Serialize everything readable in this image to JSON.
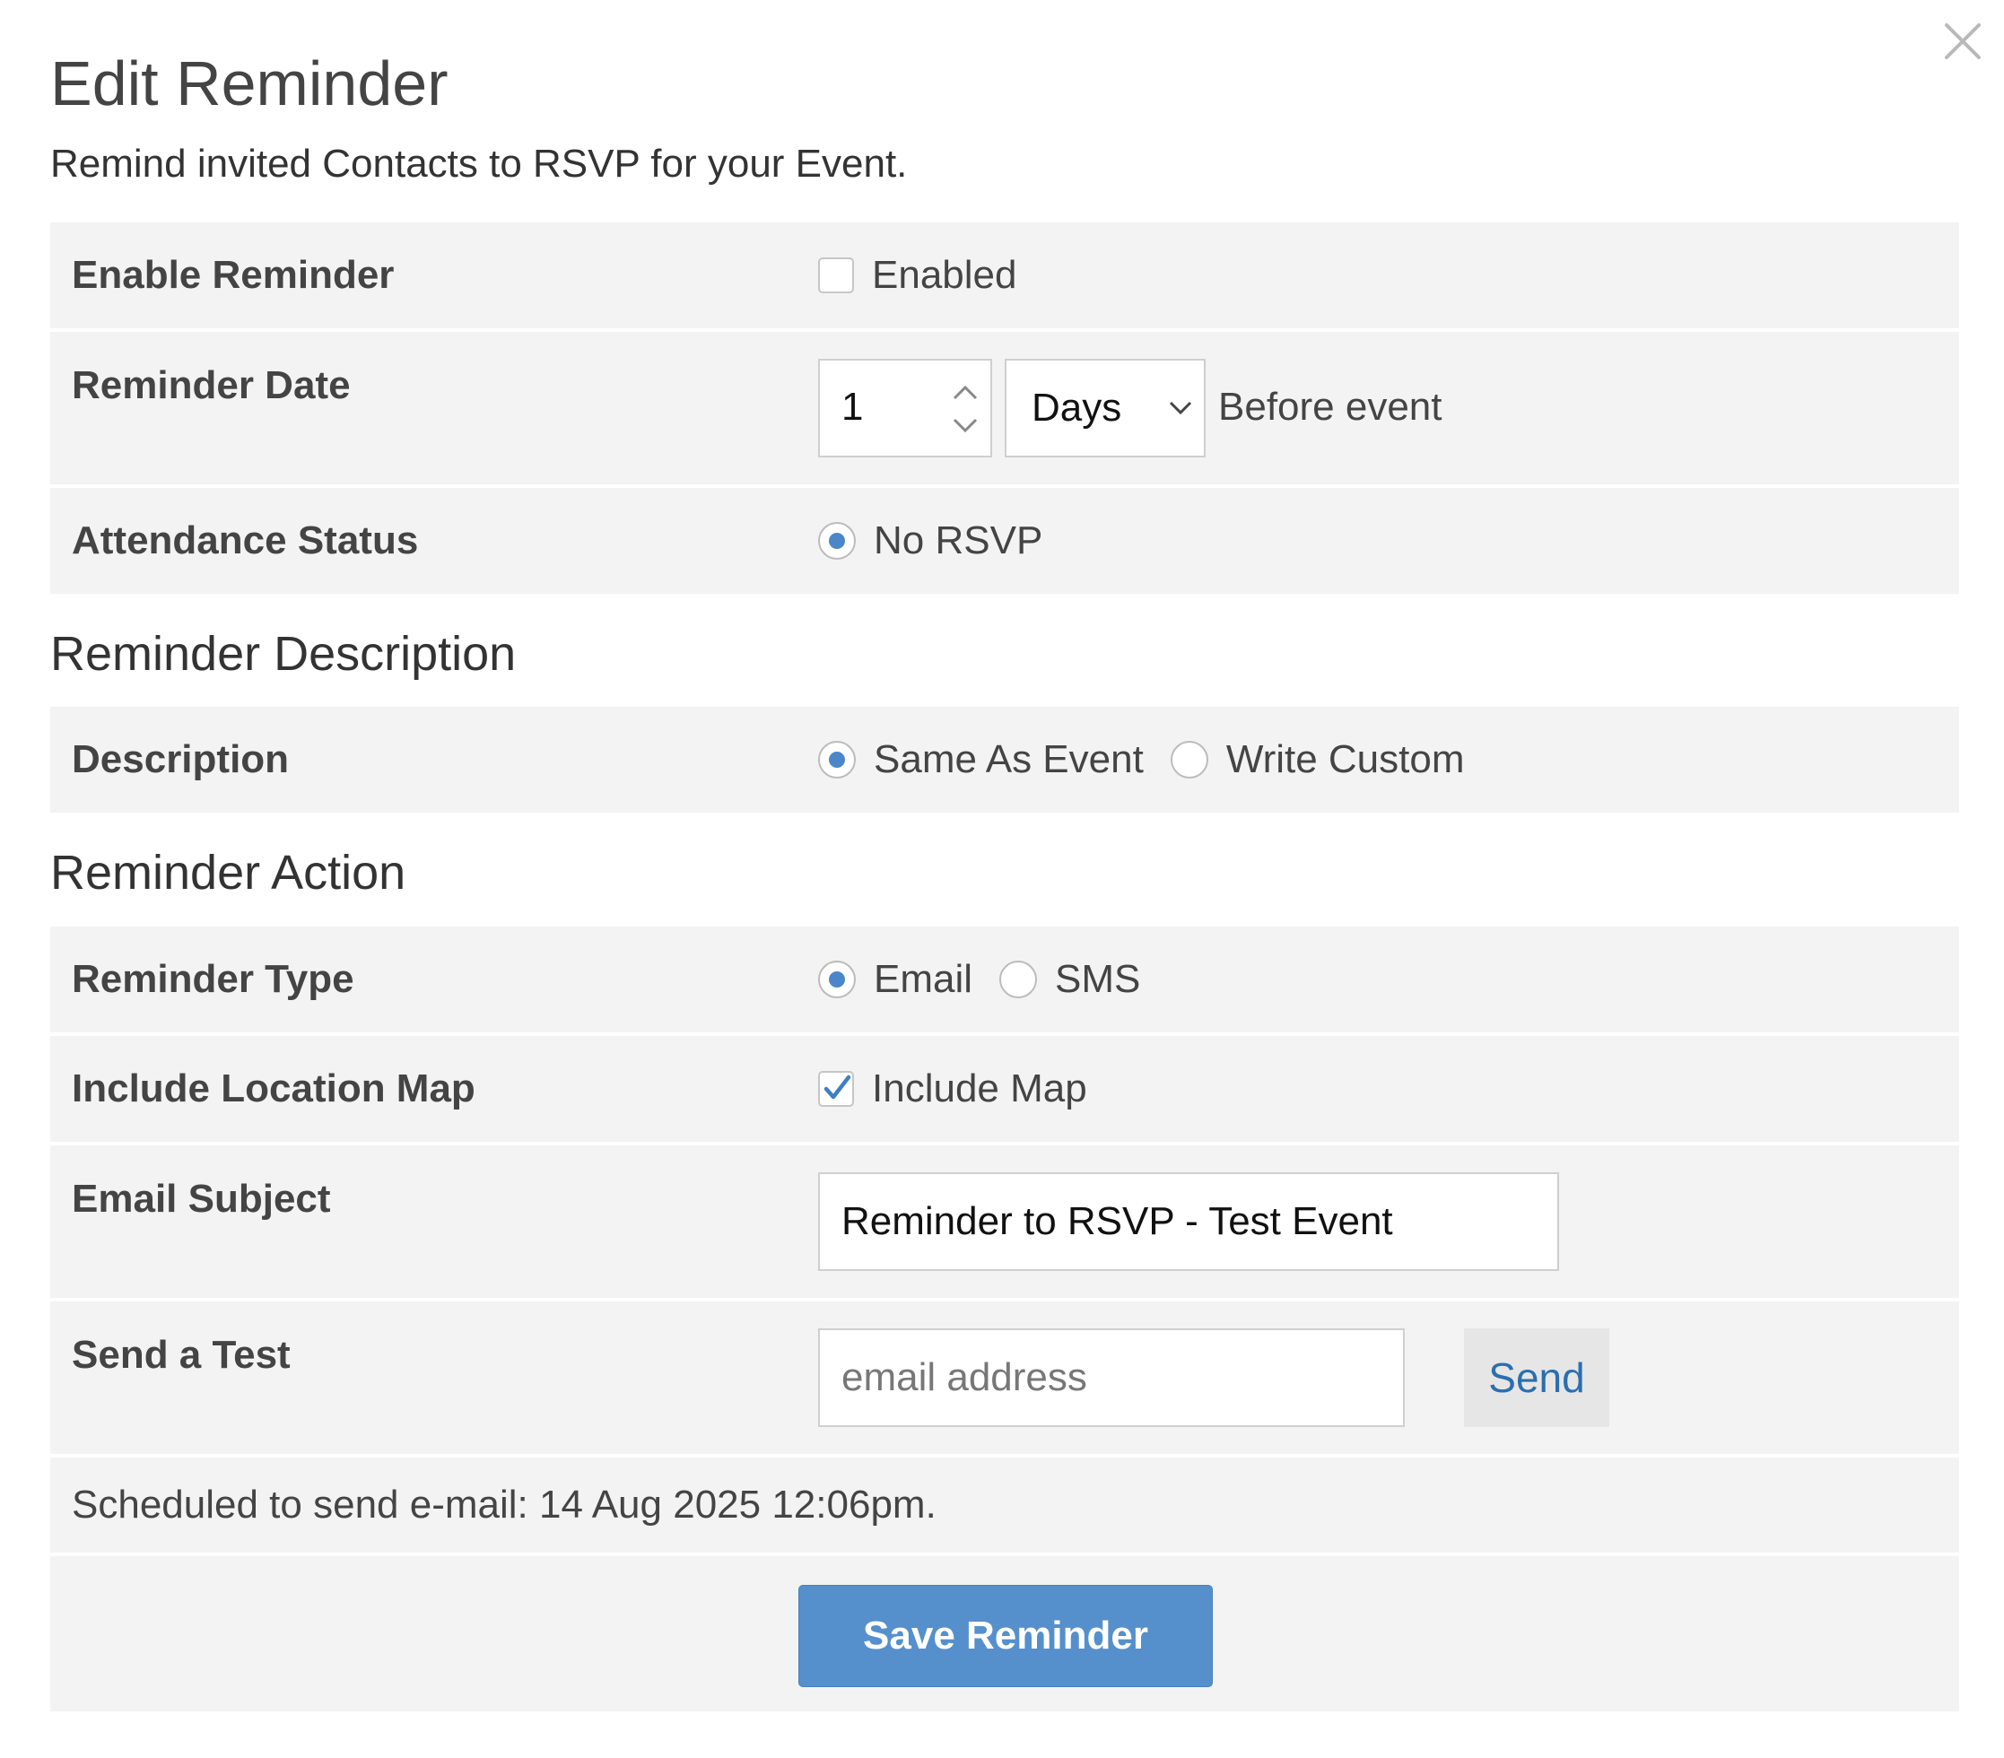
{
  "dialog": {
    "title": "Edit Reminder",
    "subtitle": "Remind invited Contacts to RSVP for your Event.",
    "close_icon": "close-icon"
  },
  "settings": {
    "enable_reminder": {
      "label": "Enable Reminder",
      "option": "Enabled",
      "checked": false
    },
    "reminder_date": {
      "label": "Reminder Date",
      "amount": "1",
      "unit": "Days",
      "suffix": "Before event"
    },
    "attendance_status": {
      "label": "Attendance Status",
      "option": "No RSVP",
      "selected": true
    }
  },
  "description_section": {
    "heading": "Reminder Description",
    "description": {
      "label": "Description",
      "options": [
        "Same As Event",
        "Write Custom"
      ],
      "selected": "Same As Event"
    }
  },
  "action_section": {
    "heading": "Reminder Action",
    "reminder_type": {
      "label": "Reminder Type",
      "options": [
        "Email",
        "SMS"
      ],
      "selected": "Email"
    },
    "location_map": {
      "label": "Include Location Map",
      "option": "Include Map",
      "checked": true
    },
    "email_subject": {
      "label": "Email Subject",
      "value": "Reminder to RSVP - Test Event"
    },
    "send_test": {
      "label": "Send a Test",
      "placeholder": "email address",
      "button": "Send"
    },
    "schedule": "Scheduled to send e-mail: 14 Aug 2025 12:06pm.",
    "save_button": "Save Reminder"
  },
  "colors": {
    "accent": "#4a86c8",
    "button_primary": "#5590cc",
    "link": "#2a6fb0",
    "row_background": "#f3f3f3"
  }
}
